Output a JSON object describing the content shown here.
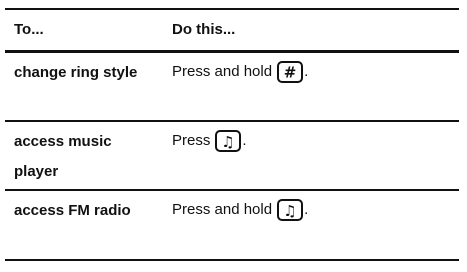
{
  "table": {
    "headers": {
      "todo": "To...",
      "dothis": "Do this..."
    },
    "rows": [
      {
        "todo": "change ring style",
        "action": "Press and hold",
        "key_icon": "pound-key-icon",
        "key_glyph": "#",
        "end": "."
      },
      {
        "todo": "access music player",
        "action": "Press",
        "key_icon": "music-key-icon",
        "key_glyph": "♫",
        "end": "."
      },
      {
        "todo": "access FM radio",
        "action": "Press and hold",
        "key_icon": "music-key-icon",
        "key_glyph": "♫",
        "end": "."
      }
    ]
  }
}
